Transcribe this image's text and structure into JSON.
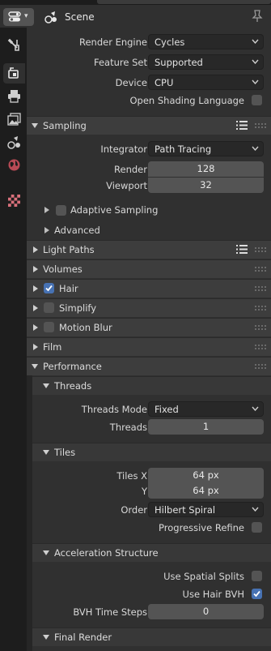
{
  "header": {
    "title": "Scene"
  },
  "tabs": [
    "tool",
    "render",
    "output",
    "view-layer",
    "scene",
    "world",
    "texture"
  ],
  "render_engine": {
    "label": "Render Engine",
    "value": "Cycles"
  },
  "feature_set": {
    "label": "Feature Set",
    "value": "Supported"
  },
  "device": {
    "label": "Device",
    "value": "CPU"
  },
  "osl": {
    "label": "Open Shading Language",
    "checked": false
  },
  "sampling": {
    "title": "Sampling",
    "integrator": {
      "label": "Integrator",
      "value": "Path Tracing"
    },
    "render": {
      "label": "Render",
      "value": "128"
    },
    "viewport": {
      "label": "Viewport",
      "value": "32"
    },
    "adaptive": {
      "label": "Adaptive Sampling",
      "checked": false
    },
    "advanced": {
      "label": "Advanced"
    }
  },
  "panels": {
    "light_paths": "Light Paths",
    "volumes": "Volumes",
    "hair": {
      "label": "Hair",
      "checked": true
    },
    "simplify": {
      "label": "Simplify",
      "checked": false
    },
    "motion_blur": {
      "label": "Motion Blur",
      "checked": false
    },
    "film": "Film",
    "performance": "Performance"
  },
  "threads": {
    "title": "Threads",
    "mode": {
      "label": "Threads Mode",
      "value": "Fixed"
    },
    "count": {
      "label": "Threads",
      "value": "1"
    }
  },
  "tiles": {
    "title": "Tiles",
    "x": {
      "label": "Tiles X",
      "value": "64 px"
    },
    "y": {
      "label": "Y",
      "value": "64 px"
    },
    "order": {
      "label": "Order",
      "value": "Hilbert Spiral"
    },
    "progressive": {
      "label": "Progressive Refine",
      "checked": false
    }
  },
  "accel": {
    "title": "Acceleration Structure",
    "spatial": {
      "label": "Use Spatial Splits",
      "checked": false
    },
    "hair_bvh": {
      "label": "Use Hair BVH",
      "checked": true
    },
    "bvh_steps": {
      "label": "BVH Time Steps",
      "value": "0"
    }
  },
  "final_render": {
    "title": "Final Render"
  },
  "colors": {
    "accent": "#4772b3",
    "background": "#303030",
    "field": "#545454"
  }
}
